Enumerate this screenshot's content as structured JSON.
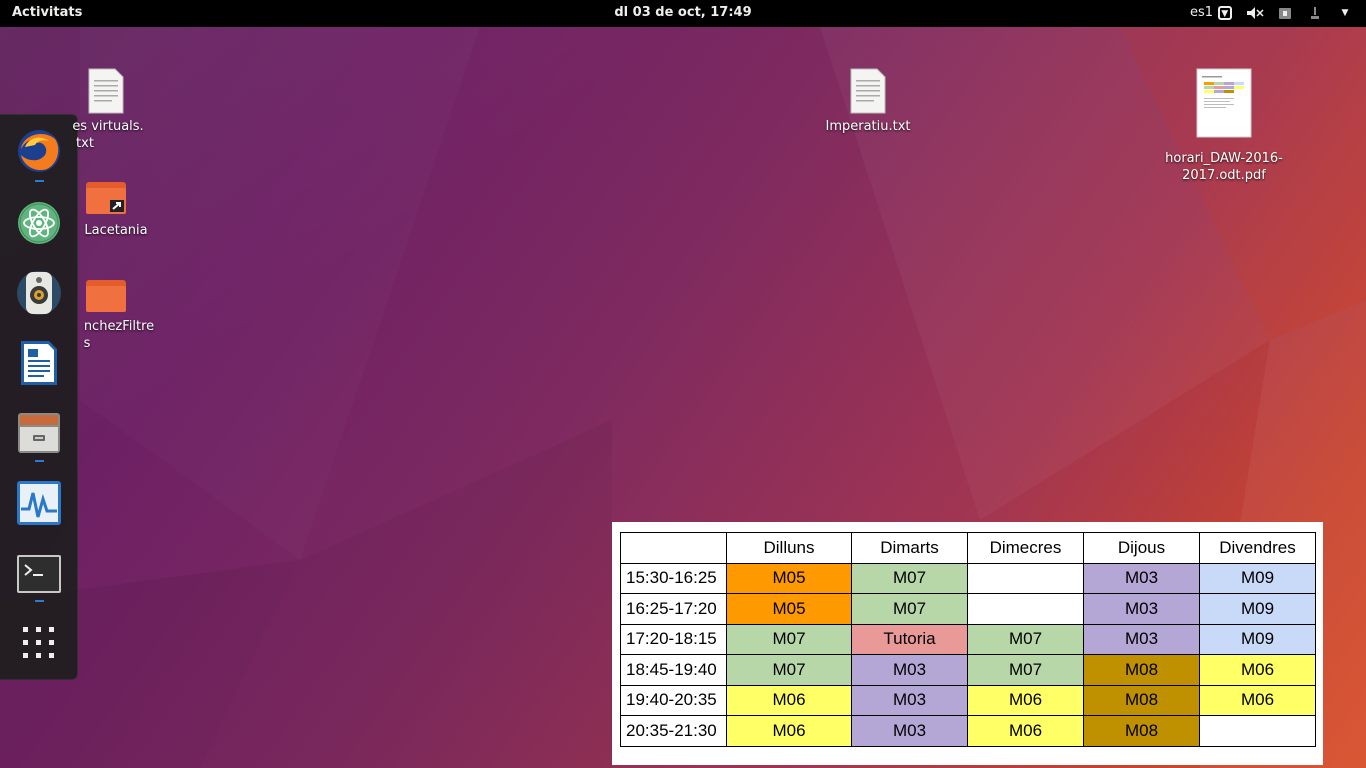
{
  "topbar": {
    "activities": "Activitats",
    "clock": "dl 03 de oct, 17:49",
    "keyboard": "es1",
    "tray_icons": [
      "screen-icon",
      "volume-muted-icon",
      "battery-icon",
      "power-menu-icon"
    ]
  },
  "dock": {
    "apps": [
      {
        "name": "Firefox",
        "icon": "firefox-icon",
        "running": true
      },
      {
        "name": "Atom",
        "icon": "atom-icon",
        "running": false
      },
      {
        "name": "Rhythmbox",
        "icon": "speaker-icon",
        "running": false
      },
      {
        "name": "LibreOffice Writer",
        "icon": "writer-icon",
        "running": false
      },
      {
        "name": "Files",
        "icon": "file-cabinet-icon",
        "running": true
      },
      {
        "name": "System Monitor",
        "icon": "system-monitor-icon",
        "running": false
      },
      {
        "name": "Terminal",
        "icon": "terminal-icon",
        "running": true
      },
      {
        "name": "Show Applications",
        "icon": "app-grid-icon",
        "running": false
      }
    ]
  },
  "desktop_icons": [
    {
      "label_line1": "es virtuals.",
      "label_line2": "txt",
      "type": "text-file"
    },
    {
      "label_line1": "Lacetania",
      "label_line2": "",
      "type": "folder-link"
    },
    {
      "label_line1": "nchezFiltre",
      "label_line2": "s",
      "type": "folder"
    },
    {
      "label_line1": "Imperatiu.txt",
      "label_line2": "",
      "type": "text-file"
    },
    {
      "label_line1": "horari_DAW-2016-",
      "label_line2": "2017.odt.pdf",
      "type": "pdf"
    }
  ],
  "timetable": {
    "headers": [
      "",
      "Dilluns",
      "Dimarts",
      "Dimecres",
      "Dijous",
      "Divendres"
    ],
    "rows": [
      {
        "time": "15:30-16:25",
        "cells": [
          "M05",
          "M07",
          "",
          "M03",
          "M09"
        ]
      },
      {
        "time": "16:25-17:20",
        "cells": [
          "M05",
          "M07",
          "",
          "M03",
          "M09"
        ]
      },
      {
        "time": "17:20-18:15",
        "cells": [
          "M07",
          "Tutoria",
          "M07",
          "M03",
          "M09"
        ]
      },
      {
        "time": "18:45-19:40",
        "cells": [
          "M07",
          "M03",
          "M07",
          "M08",
          "M06"
        ]
      },
      {
        "time": "19:40-20:35",
        "cells": [
          "M06",
          "M03",
          "M06",
          "M08",
          "M06"
        ]
      },
      {
        "time": "20:35-21:30",
        "cells": [
          "M06",
          "M03",
          "M06",
          "M08",
          ""
        ]
      }
    ],
    "colors": {
      "M05": "#ff9900",
      "M07": "#b7d7a8",
      "M03": "#b4a7d6",
      "M09": "#c9daf8",
      "M08": "#bf9000",
      "M06": "#ffff66",
      "Tutoria": "#ea9999",
      "": "#ffffff"
    }
  }
}
